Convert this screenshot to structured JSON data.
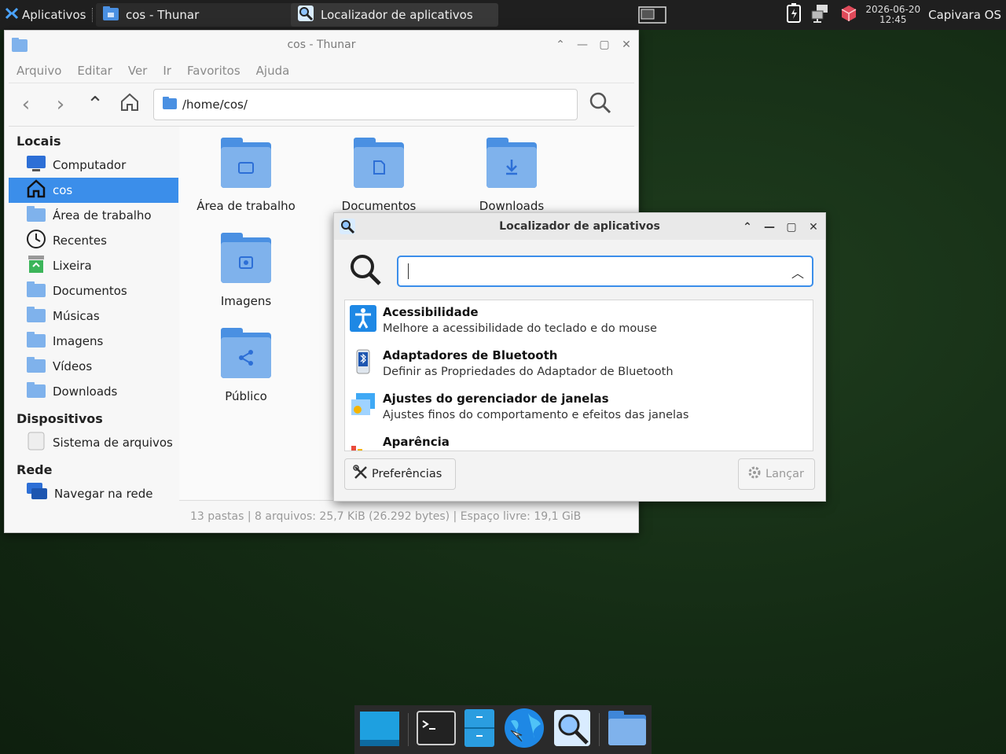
{
  "panel": {
    "apps_label": "Aplicativos",
    "tasks": [
      {
        "label": "cos - Thunar"
      },
      {
        "label": "Localizador de aplicativos"
      }
    ],
    "clock_date": "2026-06-20",
    "clock_time": "12:45",
    "user": "Capivara OS"
  },
  "thunar": {
    "title": "cos - Thunar",
    "menu": [
      "Arquivo",
      "Editar",
      "Ver",
      "Ir",
      "Favoritos",
      "Ajuda"
    ],
    "path": "/home/cos/",
    "sidebar": {
      "locais_header": "Locais",
      "locais": [
        "Computador",
        "cos",
        "Área de trabalho",
        "Recentes",
        "Lixeira",
        "Documentos",
        "Músicas",
        "Imagens",
        "Vídeos",
        "Downloads"
      ],
      "dispositivos_header": "Dispositivos",
      "dispositivos": [
        "Sistema de arquivos"
      ],
      "rede_header": "Rede",
      "rede": [
        "Navegar na rede"
      ]
    },
    "files": [
      "Área de trabalho",
      "Documentos",
      "Downloads",
      "Imagens",
      "Público"
    ],
    "status": "13 pastas  |  8 arquivos: 25,7 KiB (26.292 bytes)  |  Espaço livre: 19,1 GiB"
  },
  "finder": {
    "title": "Localizador de aplicativos",
    "search_value": "",
    "results": [
      {
        "name": "Acessibilidade",
        "desc": "Melhore a acessibilidade do teclado e do mouse"
      },
      {
        "name": "Adaptadores de Bluetooth",
        "desc": "Definir as Propriedades do Adaptador de Bluetooth"
      },
      {
        "name": "Ajustes do gerenciador de janelas",
        "desc": "Ajustes finos do comportamento e efeitos das janelas"
      },
      {
        "name": "Aparência",
        "desc": ""
      }
    ],
    "prefs_label": "Preferências",
    "launch_label": "Lançar"
  },
  "colors": {
    "accent": "#3b8eea",
    "folder": "#4a90e2",
    "panel": "#1f1f1f"
  }
}
